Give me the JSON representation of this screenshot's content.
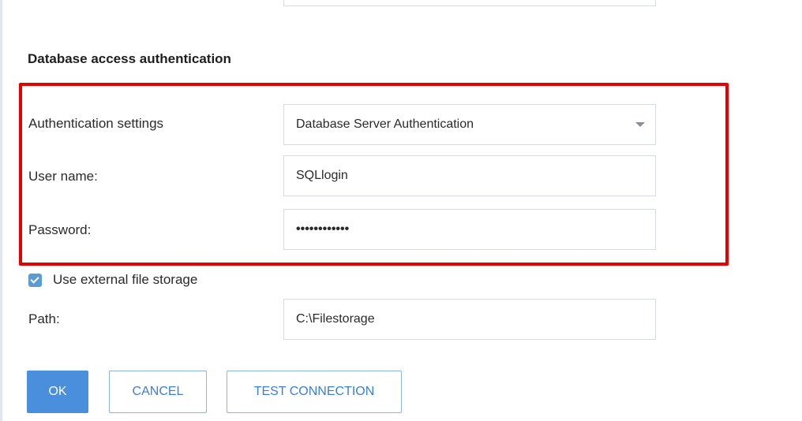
{
  "section": {
    "title": "Database access authentication"
  },
  "auth": {
    "settings_label": "Authentication settings",
    "settings_value": "Database Server Authentication",
    "username_label": "User name:",
    "username_value": "SQLlogin",
    "password_label": "Password:",
    "password_value": "••••••••••••"
  },
  "storage": {
    "checkbox_label": "Use external file storage",
    "checked": true,
    "path_label": "Path:",
    "path_value": "C:\\Filestorage"
  },
  "buttons": {
    "ok": "OK",
    "cancel": "CANCEL",
    "test": "TEST CONNECTION"
  },
  "colors": {
    "highlight": "#e50000",
    "primary": "#4a8fdb",
    "checkbox": "#5b9bd5"
  }
}
